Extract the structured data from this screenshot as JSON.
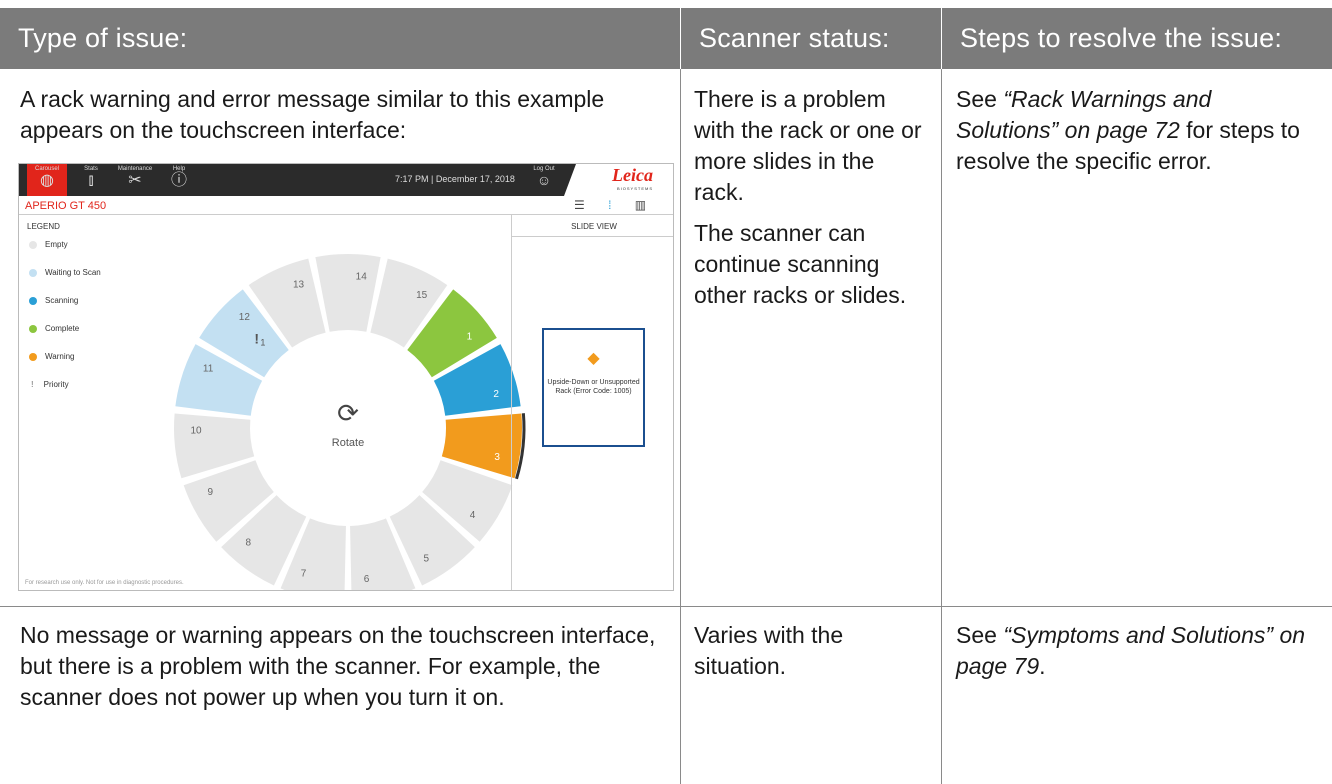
{
  "headers": {
    "type_of_issue": "Type of issue:",
    "scanner_status": "Scanner status:",
    "steps": "Steps to resolve the issue:"
  },
  "row1": {
    "issue": "A rack warning and error message similar to this example appears on the touchscreen interface:",
    "status_p1": "There is a problem with the rack or one or more slides in the rack.",
    "status_p2": "The scanner can continue scanning other racks or slides.",
    "steps_prefix": "See ",
    "steps_link": "“Rack Warnings and Solutions” on page 72",
    "steps_suffix": " for steps to resolve the specific error."
  },
  "row2": {
    "issue": "No message or warning appears on the touchscreen interface, but there is a problem with the scanner. For example, the scanner does not power up when you turn it on.",
    "status": "Varies with the situation.",
    "steps_prefix": "See ",
    "steps_link": "“Symptoms and Solutions” on page 79",
    "steps_suffix": "."
  },
  "touchscreen": {
    "nav": [
      {
        "label": "Carousel",
        "icon": "carousel-icon",
        "glyph": "◍",
        "active": true
      },
      {
        "label": "Stats",
        "icon": "stats-icon",
        "glyph": "⫾",
        "active": false
      },
      {
        "label": "Maintenance",
        "icon": "tools-icon",
        "glyph": "✂",
        "active": false
      },
      {
        "label": "Help",
        "icon": "help-icon",
        "glyph": "ⓘ",
        "active": false
      }
    ],
    "datetime": "7:17 PM  |  December 17, 2018",
    "logout_label": "Log Out",
    "logo_brand": "Leica",
    "logo_sub": "BIOSYSTEMS",
    "product_title": "APERIO GT 450",
    "legend_title": "LEGEND",
    "legend": [
      {
        "label": "Empty",
        "color": "#e6e6e6"
      },
      {
        "label": "Waiting to Scan",
        "color": "#c3e0f2"
      },
      {
        "label": "Scanning",
        "color": "#2a9fd6"
      },
      {
        "label": "Complete",
        "color": "#8cc63f"
      },
      {
        "label": "Warning",
        "color": "#f29b1d"
      },
      {
        "label": "Priority",
        "color": "#999999"
      }
    ],
    "rotate_label": "Rotate",
    "slide_view_title": "SLIDE VIEW",
    "error_text": "Upside-Down or Unsupported Rack (Error Code: 1005)",
    "footer": "For research use only. Not for use in diagnostic procedures.",
    "racks": [
      {
        "n": "1",
        "state": "complete"
      },
      {
        "n": "2",
        "state": "scanning"
      },
      {
        "n": "3",
        "state": "warning"
      },
      {
        "n": "4",
        "state": "empty"
      },
      {
        "n": "5",
        "state": "empty"
      },
      {
        "n": "6",
        "state": "empty"
      },
      {
        "n": "7",
        "state": "empty"
      },
      {
        "n": "8",
        "state": "empty"
      },
      {
        "n": "9",
        "state": "empty"
      },
      {
        "n": "10",
        "state": "empty"
      },
      {
        "n": "11",
        "state": "waiting"
      },
      {
        "n": "12",
        "state": "waiting"
      },
      {
        "n": "13",
        "state": "empty"
      },
      {
        "n": "14",
        "state": "empty"
      },
      {
        "n": "15",
        "state": "empty"
      }
    ],
    "priority_rack_label": "1"
  }
}
